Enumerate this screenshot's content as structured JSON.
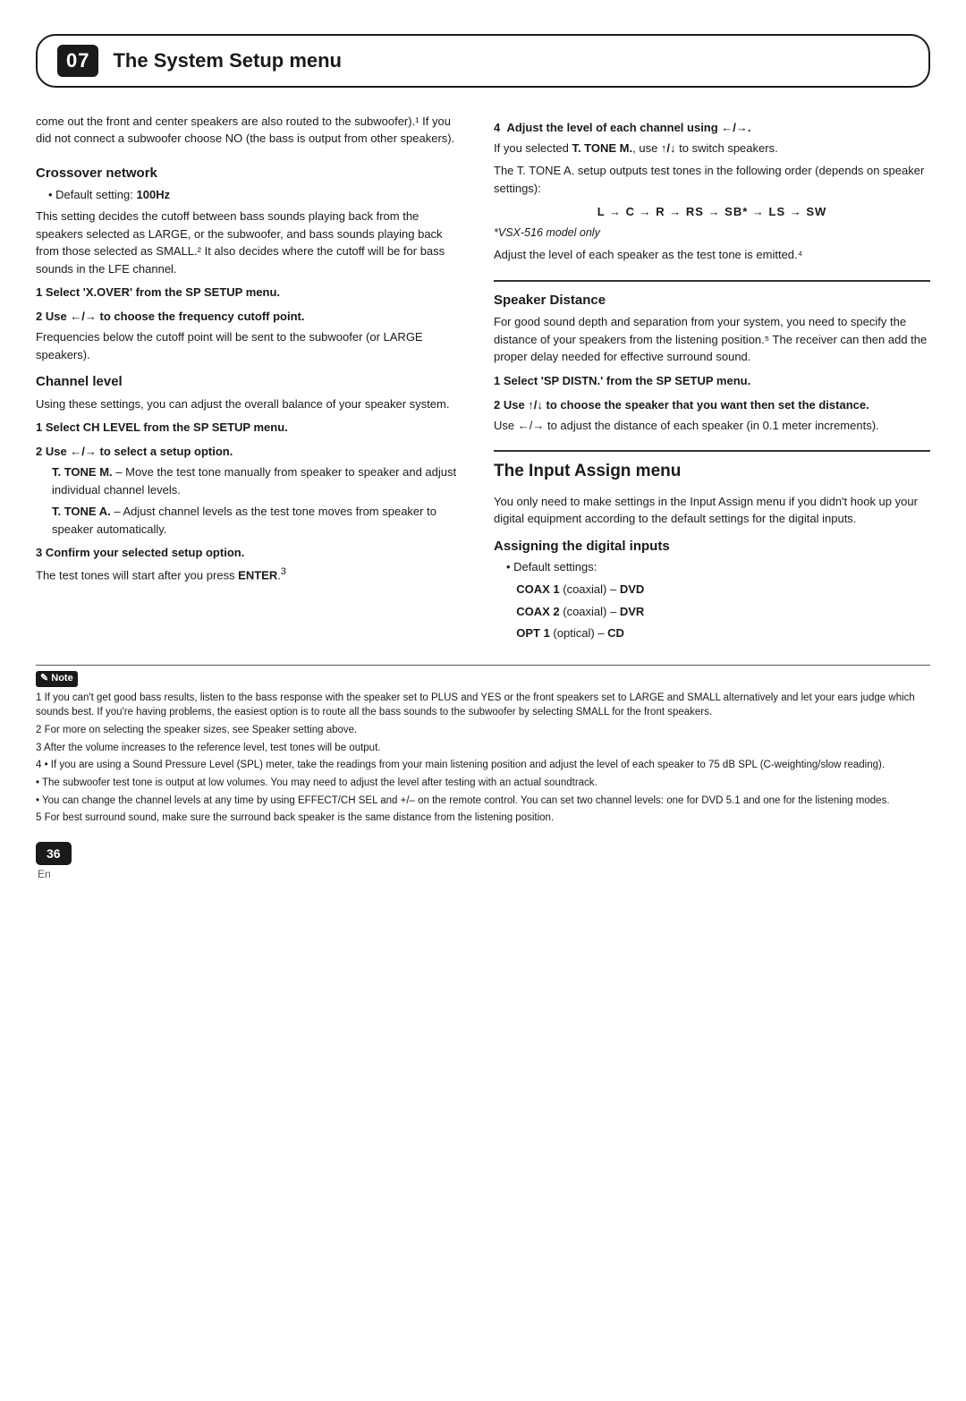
{
  "header": {
    "number": "07",
    "title": "The System Setup menu"
  },
  "left": {
    "intro": "come out the front and center speakers are also routed to the subwoofer).¹ If you did not connect a subwoofer choose NO (the bass is output from other speakers).",
    "crossover": {
      "heading": "Crossover network",
      "default": "100Hz",
      "body": "This setting decides the cutoff between bass sounds playing back from the speakers selected as LARGE, or the subwoofer, and bass sounds playing back from those selected as SMALL.² It also decides where the cutoff will be for bass sounds in the LFE channel.",
      "step1": "1   Select 'X.OVER' from the SP SETUP menu.",
      "step2": "2   Use ←/→ to choose the frequency cutoff point.",
      "step2body": "Frequencies below the cutoff point will be sent to the subwoofer (or LARGE speakers)."
    },
    "channel": {
      "heading": "Channel level",
      "intro": "Using these settings, you can adjust the overall balance of your speaker system.",
      "step1": "1   Select CH LEVEL from the SP SETUP menu.",
      "step2": "2   Use ←/→ to select a setup option.",
      "bullet1": "– Move the test tone manually from speaker to speaker and adjust individual channel levels.",
      "bullet2": "– Adjust channel levels as the test tone moves from speaker to speaker automatically.",
      "step3": "3   Confirm your selected setup option."
    }
  },
  "right": {
    "ttoneDesc": "The T. TONE A. setup outputs test tones in the following order (depends on speaker settings):",
    "toneSequence": "L → C → R → RS → SB* → LS → SW",
    "modelOnly": "*VSX-516 model only",
    "adjustDesc": "Adjust the level of each speaker as the test tone is emitted.⁴",
    "speakerDistance": {
      "heading": "Speaker Distance",
      "intro": "For good sound depth and separation from your system, you need to specify the distance of your speakers from the listening position.⁵ The receiver can then add the proper delay needed for effective surround sound.",
      "step1": "1   Select 'SP DISTN.' from the SP SETUP menu.",
      "step2": "2   Use ↑/↓ to choose the speaker that you want then set the distance.",
      "step2body": "Use ←/→ to adjust the distance of each speaker (in 0.1 meter increments)."
    },
    "inputAssign": {
      "heading": "The Input Assign menu",
      "intro": "You only need to make settings in the Input Assign menu if you didn't hook up your digital equipment according to the default settings for the digital inputs.",
      "subheading": "Assigning the digital inputs",
      "defaults": [
        {
          "label": "COAX 1",
          "type": "coaxial",
          "device": "DVD"
        },
        {
          "label": "COAX 2",
          "type": "coaxial",
          "device": "DVR"
        },
        {
          "label": "OPT 1",
          "type": "optical",
          "device": "CD"
        }
      ]
    }
  },
  "notes": {
    "note1": "1 If you can't get good bass results, listen to the bass response with the speaker set to PLUS and YES or the front speakers set to LARGE and SMALL alternatively and let your ears judge which sounds best. If you're having problems, the easiest option is to route all the bass sounds to the subwoofer by selecting SMALL for the front speakers.",
    "note2": "2 For more on selecting the speaker sizes, see Speaker setting above.",
    "note3": "3 After the volume increases to the reference level, test tones will be output.",
    "note4": "4 • If you are using a Sound Pressure Level (SPL) meter, take the readings from your main listening position and adjust the level of each speaker to 75 dB SPL (C-weighting/slow reading).",
    "note4b": "  • The subwoofer test tone is output at low volumes. You may need to adjust the level after testing with an actual soundtrack.",
    "note4c": "  • You can change the channel levels at any time by using EFFECT/CH SEL and +/– on the remote control. You can set two channel levels: one for DVD 5.1 and one for the listening modes.",
    "note5": "5 For best surround sound, make sure the surround back speaker is the same distance from the listening position."
  },
  "footer": {
    "pageNumber": "36",
    "lang": "En"
  }
}
